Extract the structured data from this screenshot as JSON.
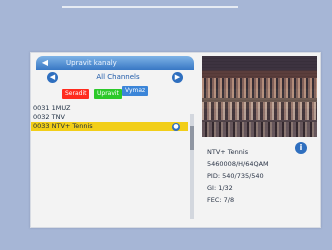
{
  "menu": {
    "title": "Upravit kanaly",
    "group_label": "All Channels",
    "buttons": {
      "red": "Seradit",
      "green": "Upravit",
      "blue": "Vymaz"
    },
    "channels": [
      {
        "label": "0031 1MUZ",
        "selected": false
      },
      {
        "label": "0032 TNV",
        "selected": false
      },
      {
        "label": "0033 NTV+ Tennis",
        "selected": true
      }
    ]
  },
  "info": {
    "name": "NTV+ Tennis",
    "freq": "5460008/H/64QAM",
    "pid": "PID: 540/735/540",
    "gi": "GI: 1/32",
    "fec": "FEC: 7/8"
  },
  "icons": {
    "back": "arrow-left-icon",
    "prev": "chevron-left-icon",
    "next": "chevron-right-icon",
    "info": "info-icon",
    "favorite": "favorite-icon"
  },
  "colors": {
    "background": "#a6b6d6",
    "panel": "#f3f3f3",
    "selection": "#f2ce18",
    "accent_blue": "#3978c4",
    "button_red": "#ff2b1e",
    "button_green": "#2cc92a",
    "button_blue": "#3b85d8"
  }
}
